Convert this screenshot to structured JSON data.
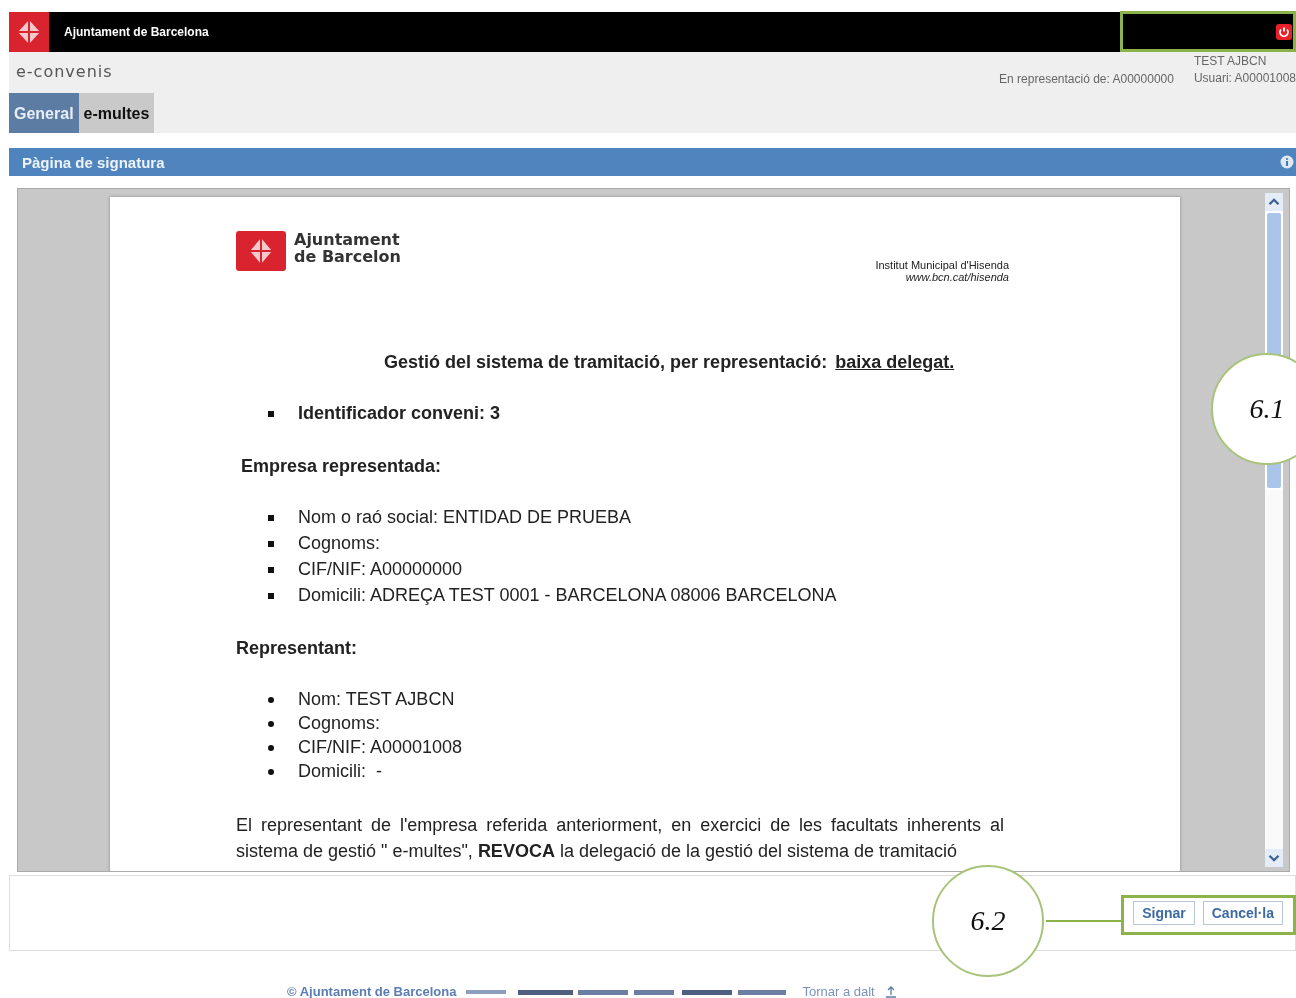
{
  "top_bar": {
    "title": "Ajuntament de Barcelona"
  },
  "header": {
    "app_name": "e-convenis",
    "represented": "En representació de: A00000000",
    "user_name": "TEST AJBCN",
    "user_id": "Usuari: A00001008"
  },
  "tabs": [
    {
      "label": "General",
      "selected": true
    },
    {
      "label": "e-multes",
      "selected": false
    }
  ],
  "section_bar": {
    "title": "Pàgina de signatura"
  },
  "document": {
    "logo_line_1": "Ajuntament",
    "logo_line_2": "de Barcelon",
    "institute": "Institut Municipal d'Hisenda",
    "institute_url": "www.bcn.cat/hisenda",
    "heading": "Gestió del sistema de tramitació, per representació:",
    "heading_link": "baixa delegat.",
    "id_list": {
      "kind": "square",
      "items": [
        "Identificador conveni: 3"
      ]
    },
    "company_title": "Empresa representada:",
    "company_list": {
      "kind": "square",
      "items": [
        "Nom o raó social: ENTIDAD DE PRUEBA",
        "Cognoms:",
        "CIF/NIF: A00000000",
        "Domicili: ADREÇA TEST 0001 - BARCELONA 08006 BARCELONA"
      ]
    },
    "representative_title": "Representant:",
    "representative_list": {
      "kind": "round",
      "items": [
        "Nom: TEST AJBCN",
        "Cognoms:",
        "CIF/NIF: A00001008",
        "Domicili:  -"
      ]
    },
    "paragraph": "El representant de l'empresa referida anteriorment, en exercici de les facultats inherents al sistema de gestió \" e-multes\", **REVOCA** la delegació de la gestió del sistema de tramitació"
  },
  "buttons": [
    "Signar",
    "Cancel·la"
  ],
  "callouts": [
    "6.1",
    "6.2"
  ],
  "footer": {
    "copyright": "© Ajuntament de Barcelona",
    "back_to_top": "Tornar a dalt"
  }
}
